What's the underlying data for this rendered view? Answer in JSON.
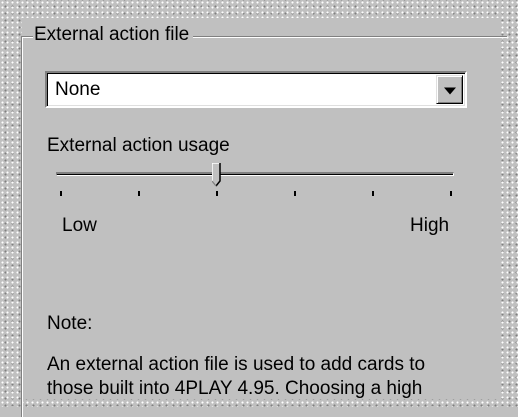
{
  "group": {
    "legend": "External action file"
  },
  "action_file_select": {
    "value": "None"
  },
  "usage_slider": {
    "label": "External action usage",
    "min_label": "Low",
    "max_label": "High",
    "tick_count": 6,
    "level": 0.4
  },
  "note": {
    "heading": "Note:",
    "line1": "An external action file is used to add cards to",
    "line2": "those built into 4PLAY 4.95. Choosing a high"
  },
  "colors": {
    "face": "#c0c0c0",
    "shadow": "#808080",
    "highlight": "#ffffff"
  }
}
